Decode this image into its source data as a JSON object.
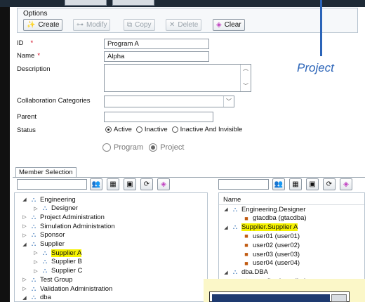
{
  "toolbar": {
    "group_label": "Options",
    "buttons": [
      {
        "label": "Create",
        "icon": "sparkle-icon",
        "enabled": true
      },
      {
        "label": "Modify",
        "icon": "key-icon",
        "enabled": false
      },
      {
        "label": "Copy",
        "icon": "copy-icon",
        "enabled": false
      },
      {
        "label": "Delete",
        "icon": "delete-x-icon",
        "enabled": false
      },
      {
        "label": "Clear",
        "icon": "eraser-icon",
        "enabled": true
      }
    ]
  },
  "form": {
    "id_label": "ID",
    "id_value": "Program A",
    "name_label": "Name",
    "name_value": "Alpha",
    "required_mark": "*",
    "description_label": "Description",
    "collab_label": "Collaboration Categories",
    "parent_label": "Parent",
    "status_label": "Status",
    "status_options": [
      {
        "label": "Active",
        "selected": true
      },
      {
        "label": "Inactive",
        "selected": false
      },
      {
        "label": "Inactive And Invisible",
        "selected": false
      }
    ],
    "type_options": [
      {
        "label": "Program",
        "selected": false
      },
      {
        "label": "Project",
        "selected": true
      }
    ]
  },
  "callout": {
    "text": "Project",
    "color": "#2b64b8"
  },
  "member_selection": {
    "tab_label": "Member Selection",
    "left_tree": [
      {
        "label": "Engineering",
        "depth": 0,
        "twisty": "◢",
        "type": "group"
      },
      {
        "label": "Designer",
        "depth": 1,
        "twisty": "▷",
        "type": "role"
      },
      {
        "label": "Project Administration",
        "depth": 0,
        "twisty": "▷",
        "type": "group"
      },
      {
        "label": "Simulation Administration",
        "depth": 0,
        "twisty": "▷",
        "type": "group"
      },
      {
        "label": "Sponsor",
        "depth": 0,
        "twisty": "▷",
        "type": "group"
      },
      {
        "label": "Supplier",
        "depth": 0,
        "twisty": "◢",
        "type": "group"
      },
      {
        "label": "Supplier A",
        "depth": 1,
        "twisty": "▷",
        "type": "role",
        "highlighted": true
      },
      {
        "label": "Supplier B",
        "depth": 1,
        "twisty": "▷",
        "type": "role"
      },
      {
        "label": "Supplier C",
        "depth": 1,
        "twisty": "▷",
        "type": "role"
      },
      {
        "label": "Test Group",
        "depth": 0,
        "twisty": "▷",
        "type": "group"
      },
      {
        "label": "Validation Administration",
        "depth": 0,
        "twisty": "▷",
        "type": "group"
      },
      {
        "label": "dba",
        "depth": 0,
        "twisty": "◢",
        "type": "group"
      }
    ],
    "right_header": "Name",
    "right_tree": [
      {
        "label": "Engineering.Designer",
        "depth": 0,
        "twisty": "◢",
        "type": "role"
      },
      {
        "label": "gtacdba (gtacdba)",
        "depth": 1,
        "twisty": "",
        "type": "user"
      },
      {
        "label": "Supplier.Supplier A",
        "depth": 0,
        "twisty": "◢",
        "type": "role",
        "highlighted": true
      },
      {
        "label": "user01 (user01)",
        "depth": 1,
        "twisty": "",
        "type": "user"
      },
      {
        "label": "user02 (user02)",
        "depth": 1,
        "twisty": "",
        "type": "user"
      },
      {
        "label": "user03 (user03)",
        "depth": 1,
        "twisty": "",
        "type": "user"
      },
      {
        "label": "user04 (user04)",
        "depth": 1,
        "twisty": "",
        "type": "user"
      },
      {
        "label": "dba.DBA",
        "depth": 0,
        "twisty": "◢",
        "type": "role"
      },
      {
        "label": "gtacdba (gtacdba)",
        "depth": 1,
        "twisty": "",
        "type": "user-star"
      }
    ],
    "left_buttons": [
      "user-search-icon",
      "group-add-icon",
      "role-add-icon",
      "refresh-icon",
      "eraser-icon"
    ],
    "right_buttons": [
      "user-search-icon",
      "group-add-icon",
      "role-add-icon",
      "refresh-icon",
      "eraser-icon"
    ]
  },
  "colors": {
    "highlight": "#f5f200",
    "accent": "#2b64b8"
  }
}
